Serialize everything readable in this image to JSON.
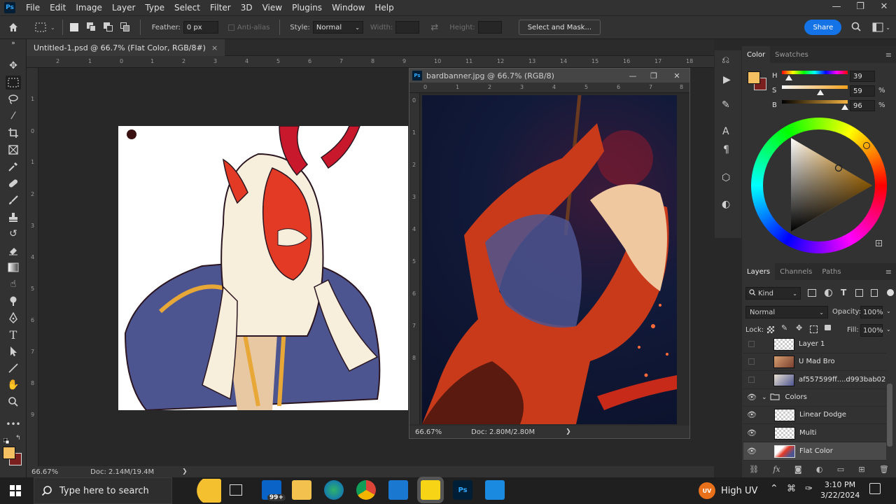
{
  "app": {
    "logo": "Ps"
  },
  "menu": [
    "File",
    "Edit",
    "Image",
    "Layer",
    "Type",
    "Select",
    "Filter",
    "3D",
    "View",
    "Plugins",
    "Window",
    "Help"
  ],
  "window_controls": {
    "minimize": "—",
    "restore": "❐",
    "close": "✕"
  },
  "options": {
    "feather_label": "Feather:",
    "feather_value": "0 px",
    "antialias_label": "Anti-alias",
    "style_label": "Style:",
    "style_value": "Normal",
    "width_label": "Width:",
    "height_label": "Height:",
    "select_mask_label": "Select and Mask...",
    "share_label": "Share"
  },
  "document_tab": {
    "title": "Untitled-1.psd @ 66.7% (Flat Color, RGB/8#)",
    "close": "×"
  },
  "ruler_top": [
    "2",
    "1",
    "0",
    "1",
    "2",
    "3",
    "4",
    "5",
    "6",
    "7",
    "8",
    "9",
    "10",
    "11",
    "12",
    "13",
    "14",
    "15",
    "16",
    "17",
    "18"
  ],
  "ruler_left": [
    "1",
    "0",
    "1",
    "2",
    "3",
    "4",
    "5",
    "6",
    "7",
    "8",
    "9"
  ],
  "status": {
    "zoom": "66.67%",
    "doc": "Doc: 2.14M/19.4M",
    "arrow": "❯"
  },
  "float_window": {
    "title": "bardbanner.jpg @ 66.7% (RGB/8)",
    "zoom": "66.67%",
    "doc": "Doc: 2.80M/2.80M",
    "arrow": "❯",
    "ruler_top": [
      "0",
      "1",
      "2",
      "3",
      "4",
      "5",
      "6",
      "7",
      "8"
    ],
    "ruler_left": [
      "0",
      "1",
      "2",
      "3",
      "4",
      "5",
      "6",
      "7",
      "8"
    ]
  },
  "color_panel": {
    "tabs": [
      "Color",
      "Swatches"
    ],
    "h_label": "H",
    "h_value": "39",
    "h_unit": "",
    "s_label": "S",
    "s_value": "59",
    "s_unit": "%",
    "b_label": "B",
    "b_value": "96",
    "b_unit": "%",
    "h_pct": 0.108,
    "s_pct": 0.59,
    "b_pct": 0.96,
    "foreground": "#f5c061",
    "background": "#7a1e1e"
  },
  "layers_panel": {
    "tabs": [
      "Layers",
      "Channels",
      "Paths"
    ],
    "filter_kind": "Kind",
    "blend_mode": "Normal",
    "opacity_label": "Opacity:",
    "opacity_value": "100%",
    "lock_label": "Lock:",
    "fill_label": "Fill:",
    "fill_value": "100%",
    "layers": [
      {
        "name": "Layer 1",
        "visible": false
      },
      {
        "name": "U Mad Bro",
        "visible": false
      },
      {
        "name": "af557599ff....d993bab02",
        "visible": false
      },
      {
        "name": "Colors",
        "visible": true,
        "group": true
      },
      {
        "name": "Linear Dodge",
        "visible": true
      },
      {
        "name": "Multi",
        "visible": true
      },
      {
        "name": "Flat Color",
        "visible": true,
        "selected": true
      }
    ]
  },
  "taskbar": {
    "search_placeholder": "Type here to search",
    "mail_badge": "99+",
    "weather_badge": "UV",
    "weather": "High UV",
    "time": "3:10 PM",
    "date": "3/22/2024"
  }
}
